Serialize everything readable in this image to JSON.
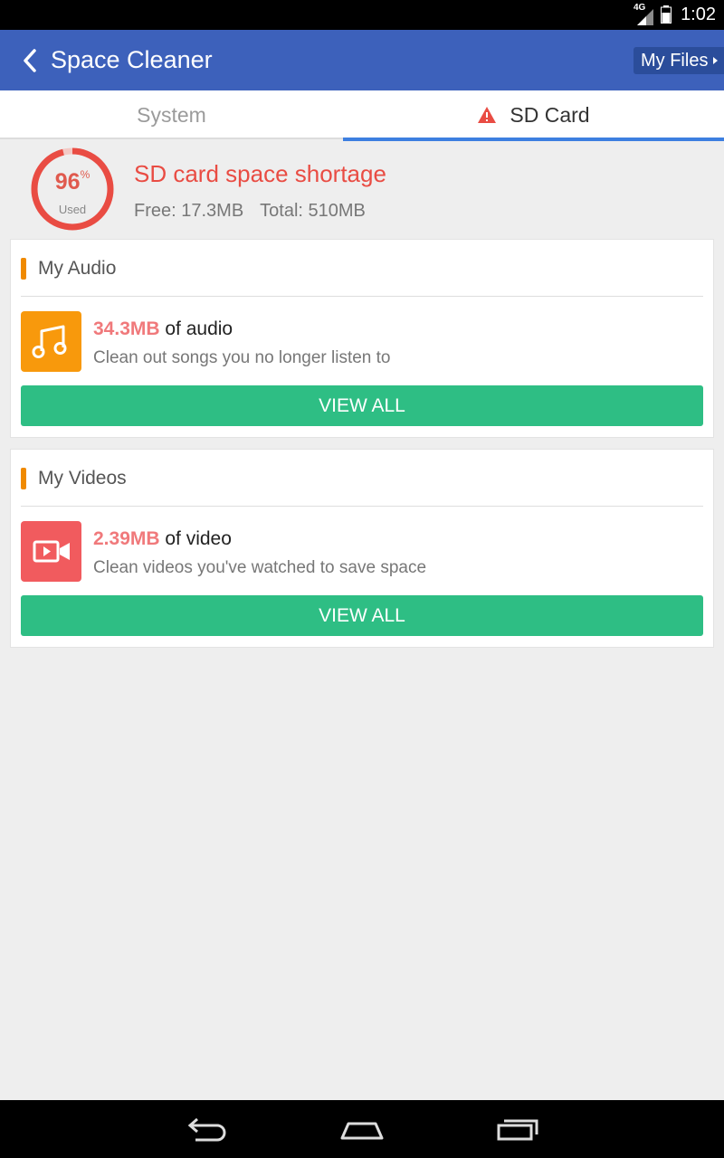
{
  "status": {
    "network": "4G",
    "time": "1:02"
  },
  "app_bar": {
    "title": "Space Cleaner",
    "my_files_label": "My Files"
  },
  "tabs": [
    {
      "label": "System",
      "selected": false
    },
    {
      "label": "SD Card",
      "selected": true
    }
  ],
  "summary": {
    "percent_used": "96",
    "percent_sign": "%",
    "used_label": "Used",
    "headline": "SD card space shortage",
    "free": "Free: 17.3MB",
    "total": "Total: 510MB",
    "ring_fraction": 0.96
  },
  "audio_card": {
    "heading": "My Audio",
    "amount": "34.3MB",
    "amount_suffix": " of audio",
    "description": "Clean out songs you no longer listen to",
    "button_label": "VIEW ALL",
    "tile_icon": "music-note-icon"
  },
  "video_card": {
    "heading": "My Videos",
    "amount": "2.39MB",
    "amount_suffix": " of video",
    "description": "Clean videos you've watched to save space",
    "button_label": "VIEW ALL",
    "tile_icon": "video-camera-icon"
  },
  "colors": {
    "app_bar": "#3d61bb",
    "accent_red": "#e94c43",
    "audio_tile": "#f8990c",
    "video_tile": "#f15b5e",
    "button_green": "#2ebe84",
    "tab_indicator": "#3d7fe0"
  }
}
